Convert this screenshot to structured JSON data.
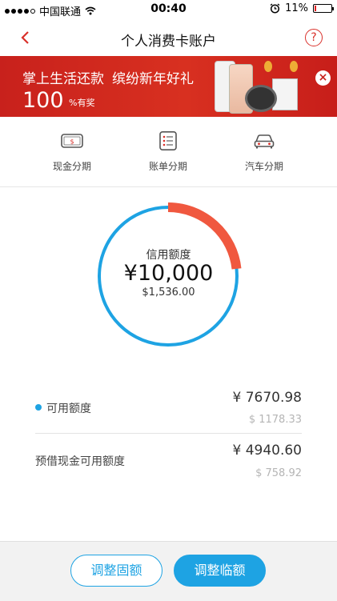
{
  "status_bar": {
    "carrier": "中国联通",
    "time": "00:40",
    "battery": "11%",
    "battery_level": 0.11
  },
  "nav": {
    "title": "个人消费卡账户",
    "help": "?"
  },
  "banner": {
    "headline_a": "掌上生活还款",
    "headline_b": "缤纷新年好礼",
    "big_number": "100",
    "suffix": "%有奖",
    "close": "×"
  },
  "quick_actions": [
    {
      "label": "现金分期",
      "icon": "cash-card-icon"
    },
    {
      "label": "账单分期",
      "icon": "bill-list-icon"
    },
    {
      "label": "汽车分期",
      "icon": "car-icon"
    }
  ],
  "gauge": {
    "title": "信用额度",
    "amount": "¥10,000",
    "used": "$1,536.00",
    "used_fraction": 0.233,
    "colors": {
      "available": "#1ea3e3",
      "used": "#f0583f"
    }
  },
  "limits": [
    {
      "label": "可用额度",
      "value": "¥ 7670.98",
      "usd": "$ 1178.33"
    },
    {
      "label": "预借现金可用额度",
      "value": "¥ 4940.60",
      "usd": "$ 758.92"
    }
  ],
  "buttons": {
    "adjust_fixed": "调整固额",
    "adjust_temp": "调整临额"
  },
  "colors": {
    "accent": "#1ea3e3",
    "brand_red": "#d9302a"
  }
}
